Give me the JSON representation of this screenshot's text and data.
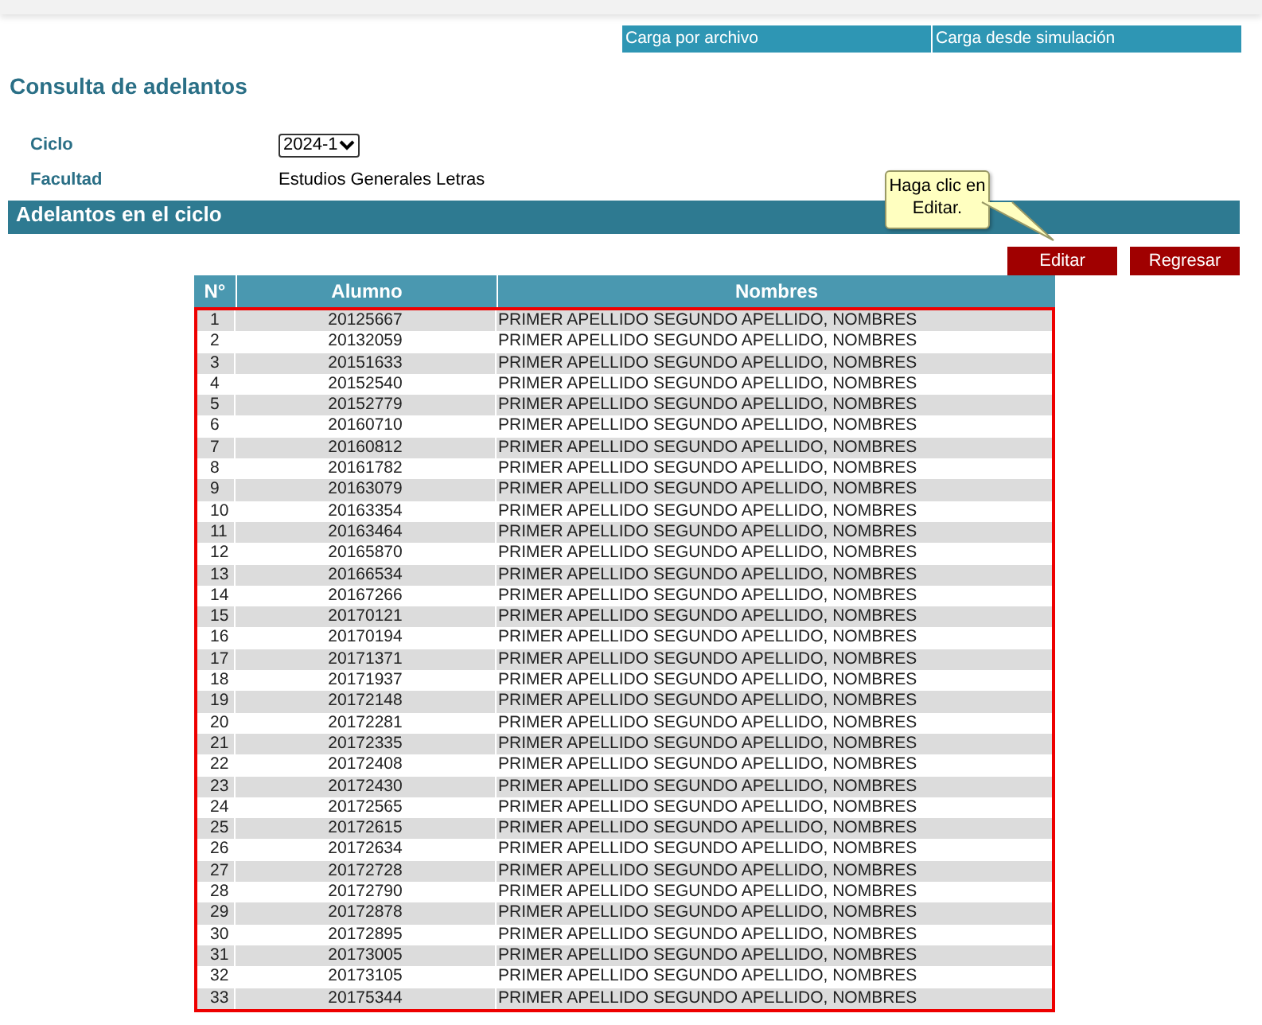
{
  "top_links": [
    "Carga por archivo",
    "Carga desde simulación"
  ],
  "title": "Consulta de adelantos",
  "fields": [
    {
      "label": "Ciclo",
      "kind": "select",
      "value": "2024-1"
    },
    {
      "label": "Facultad",
      "kind": "text",
      "value": "Estudios Generales Letras"
    }
  ],
  "section_title": "Adelantos en el ciclo",
  "tooltip": "Haga clic en Editar.",
  "buttons": [
    "Editar",
    "Regresar"
  ],
  "table": {
    "columns": [
      "N°",
      "Alumno",
      "Nombres"
    ],
    "rows": [
      [
        "1",
        "20125667",
        "PRIMER APELLIDO SEGUNDO APELLIDO, NOMBRES"
      ],
      [
        "2",
        "20132059",
        "PRIMER APELLIDO SEGUNDO APELLIDO, NOMBRES"
      ],
      [
        "3",
        "20151633",
        "PRIMER APELLIDO SEGUNDO APELLIDO, NOMBRES"
      ],
      [
        "4",
        "20152540",
        "PRIMER APELLIDO SEGUNDO APELLIDO, NOMBRES"
      ],
      [
        "5",
        "20152779",
        "PRIMER APELLIDO SEGUNDO APELLIDO, NOMBRES"
      ],
      [
        "6",
        "20160710",
        "PRIMER APELLIDO SEGUNDO APELLIDO, NOMBRES"
      ],
      [
        "7",
        "20160812",
        "PRIMER APELLIDO SEGUNDO APELLIDO, NOMBRES"
      ],
      [
        "8",
        "20161782",
        "PRIMER APELLIDO SEGUNDO APELLIDO, NOMBRES"
      ],
      [
        "9",
        "20163079",
        "PRIMER APELLIDO SEGUNDO APELLIDO, NOMBRES"
      ],
      [
        "10",
        "20163354",
        "PRIMER APELLIDO SEGUNDO APELLIDO, NOMBRES"
      ],
      [
        "11",
        "20163464",
        "PRIMER APELLIDO SEGUNDO APELLIDO, NOMBRES"
      ],
      [
        "12",
        "20165870",
        "PRIMER APELLIDO SEGUNDO APELLIDO, NOMBRES"
      ],
      [
        "13",
        "20166534",
        "PRIMER APELLIDO SEGUNDO APELLIDO, NOMBRES"
      ],
      [
        "14",
        "20167266",
        "PRIMER APELLIDO SEGUNDO APELLIDO, NOMBRES"
      ],
      [
        "15",
        "20170121",
        "PRIMER APELLIDO SEGUNDO APELLIDO, NOMBRES"
      ],
      [
        "16",
        "20170194",
        "PRIMER APELLIDO SEGUNDO APELLIDO, NOMBRES"
      ],
      [
        "17",
        "20171371",
        "PRIMER APELLIDO SEGUNDO APELLIDO, NOMBRES"
      ],
      [
        "18",
        "20171937",
        "PRIMER APELLIDO SEGUNDO APELLIDO, NOMBRES"
      ],
      [
        "19",
        "20172148",
        "PRIMER APELLIDO SEGUNDO APELLIDO, NOMBRES"
      ],
      [
        "20",
        "20172281",
        "PRIMER APELLIDO SEGUNDO APELLIDO, NOMBRES"
      ],
      [
        "21",
        "20172335",
        "PRIMER APELLIDO SEGUNDO APELLIDO, NOMBRES"
      ],
      [
        "22",
        "20172408",
        "PRIMER APELLIDO SEGUNDO APELLIDO, NOMBRES"
      ],
      [
        "23",
        "20172430",
        "PRIMER APELLIDO SEGUNDO APELLIDO, NOMBRES"
      ],
      [
        "24",
        "20172565",
        "PRIMER APELLIDO SEGUNDO APELLIDO, NOMBRES"
      ],
      [
        "25",
        "20172615",
        "PRIMER APELLIDO SEGUNDO APELLIDO, NOMBRES"
      ],
      [
        "26",
        "20172634",
        "PRIMER APELLIDO SEGUNDO APELLIDO, NOMBRES"
      ],
      [
        "27",
        "20172728",
        "PRIMER APELLIDO SEGUNDO APELLIDO, NOMBRES"
      ],
      [
        "28",
        "20172790",
        "PRIMER APELLIDO SEGUNDO APELLIDO, NOMBRES"
      ],
      [
        "29",
        "20172878",
        "PRIMER APELLIDO SEGUNDO APELLIDO, NOMBRES"
      ],
      [
        "30",
        "20172895",
        "PRIMER APELLIDO SEGUNDO APELLIDO, NOMBRES"
      ],
      [
        "31",
        "20173005",
        "PRIMER APELLIDO SEGUNDO APELLIDO, NOMBRES"
      ],
      [
        "32",
        "20173105",
        "PRIMER APELLIDO SEGUNDO APELLIDO, NOMBRES"
      ],
      [
        "33",
        "20175344",
        "PRIMER APELLIDO SEGUNDO APELLIDO, NOMBRES"
      ]
    ]
  }
}
